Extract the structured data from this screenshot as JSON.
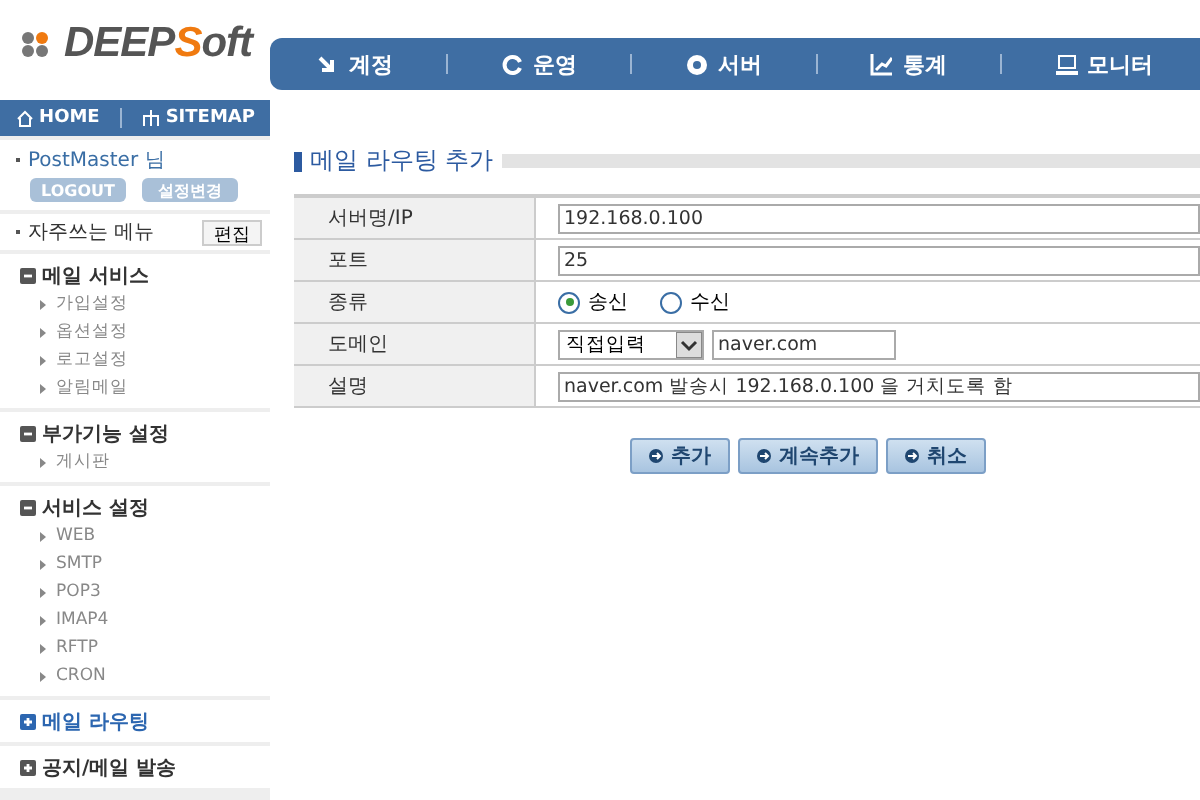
{
  "logo": {
    "text_a": "DEEP",
    "text_b": "S",
    "text_c": "oft"
  },
  "nav": [
    {
      "label": "계정"
    },
    {
      "label": "운영"
    },
    {
      "label": "서버"
    },
    {
      "label": "통계"
    },
    {
      "label": "모니터"
    }
  ],
  "top_links": [
    "HOME",
    "SITEMAP"
  ],
  "user": {
    "name": "PostMaster 님",
    "buttons": [
      "LOGOUT",
      "설정변경"
    ]
  },
  "favorites": {
    "label": "자주쓰는 메뉴",
    "edit": "편집"
  },
  "menu_groups": [
    {
      "title": "메일 서비스",
      "expanded": true,
      "selected": false,
      "items": [
        "가입설정",
        "옵션설정",
        "로고설정",
        "알림메일"
      ]
    },
    {
      "title": "부가기능 설정",
      "expanded": true,
      "selected": false,
      "items": [
        "게시판"
      ]
    },
    {
      "title": "서비스 설정",
      "expanded": true,
      "selected": false,
      "items": [
        "WEB",
        "SMTP",
        "POP3",
        "IMAP4",
        "RFTP",
        "CRON"
      ]
    },
    {
      "title": "메일 라우팅",
      "expanded": false,
      "selected": true
    },
    {
      "title": "공지/메일 발송",
      "expanded": false,
      "selected": false
    }
  ],
  "section_title": "메일 라우팅 추가",
  "form": [
    {
      "label": "서버명/IP",
      "kind": "text",
      "value": "192.168.0.100"
    },
    {
      "label": "포트",
      "kind": "text",
      "value": "25"
    },
    {
      "label": "종류",
      "kind": "radio",
      "options": [
        {
          "label": "송신",
          "selected": true
        },
        {
          "label": "수신",
          "selected": false
        }
      ]
    },
    {
      "label": "도메인",
      "kind": "domain",
      "select": "직접입력",
      "value": "naver.com"
    },
    {
      "label": "설명",
      "kind": "text",
      "value": "naver.com 발송시 192.168.0.100 을 거치도록 함"
    }
  ],
  "buttons": [
    "추가",
    "계속추가",
    "취소"
  ]
}
